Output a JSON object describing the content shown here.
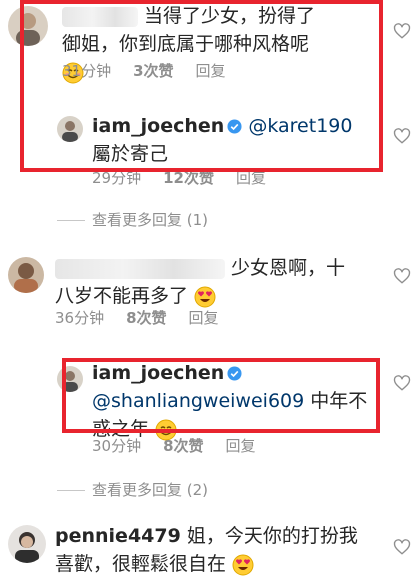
{
  "comments": [
    {
      "user": "",
      "text": "当得了少女，扮得了御姐，你到底属于哪种风格呢",
      "time": "31分钟",
      "likes": "3次赞",
      "reply": "回复"
    },
    {
      "user": "iam_joechen",
      "mention": "@karet190",
      "text": "屬於寄己",
      "time": "29分钟",
      "likes": "12次赞",
      "reply": "回复"
    },
    {
      "view_more": "查看更多回复 (1)"
    },
    {
      "user": "",
      "text": "少女恩啊，十八岁不能再多了",
      "time": "36分钟",
      "likes": "8次赞",
      "reply": "回复"
    },
    {
      "user": "iam_joechen",
      "mention": "@shanliangweiwei609",
      "text": "中年不惑之年",
      "time": "30分钟",
      "likes": "8次赞",
      "reply": "回复"
    },
    {
      "view_more": "查看更多回复 (2)"
    },
    {
      "user": "pennie4479",
      "text": "姐，今天你的打扮我喜歡，很輕鬆很自在"
    }
  ],
  "icons": {
    "like": "heart-outline-icon",
    "verified": "verified-badge-icon",
    "emoji_smile": "smiling-face-emoji",
    "emoji_heart_eyes": "heart-eyes-emoji"
  },
  "colors": {
    "highlight_box": "#e8242e",
    "mention": "#00376b",
    "meta": "#8e8e8e",
    "verified": "#3897f0"
  }
}
